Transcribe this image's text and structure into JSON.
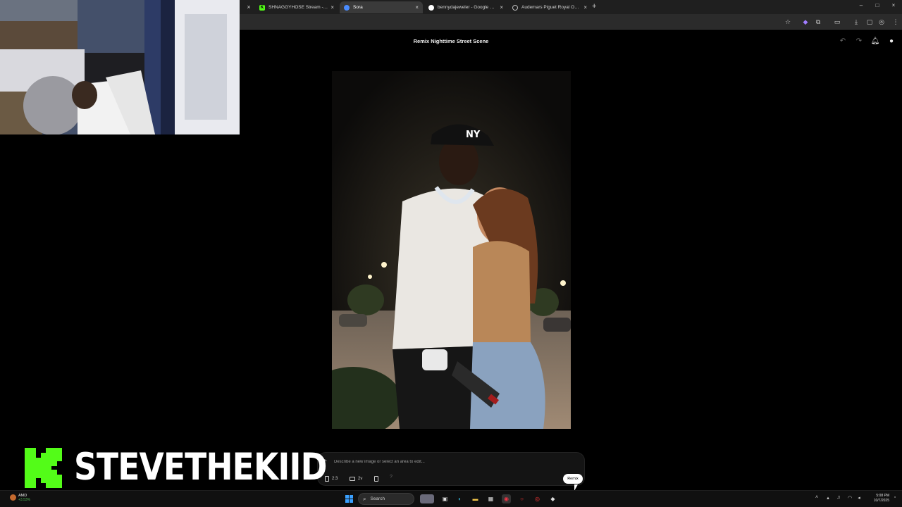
{
  "browser": {
    "lead_close": "×",
    "tabs": [
      {
        "title": "SHNAGGYHOSE Stream - Watc",
        "favicon_color": "#53fc18",
        "active": false
      },
      {
        "title": "Sora",
        "favicon_color": "#4a8cff",
        "active": true
      },
      {
        "title": "bennydajeweler - Google Sear",
        "favicon_color": "#ffffff",
        "active": false
      },
      {
        "title": "Audemars Piguet Royal Oak Dr",
        "favicon_color": "#bdbdbd",
        "active": false
      }
    ],
    "tab_close": "×",
    "new_tab": "+",
    "window_controls": [
      "–",
      "□",
      "×"
    ]
  },
  "app": {
    "title": "Remix Nighttime Street Scene",
    "composer": {
      "add": "+",
      "placeholder": "Describe a new image or select an area to edit...",
      "aspect_ratio": "2:3",
      "variations": "2v",
      "help": "?",
      "submit": "Remix"
    }
  },
  "overlay": {
    "streamer_name": "STEVETHEKIID",
    "brand_color": "#53fc18"
  },
  "taskbar": {
    "weather_label": "AMD",
    "weather_sub": "+3.53%",
    "search_label": "Search",
    "time": "5:08 PM",
    "date": "10/7/2025"
  }
}
